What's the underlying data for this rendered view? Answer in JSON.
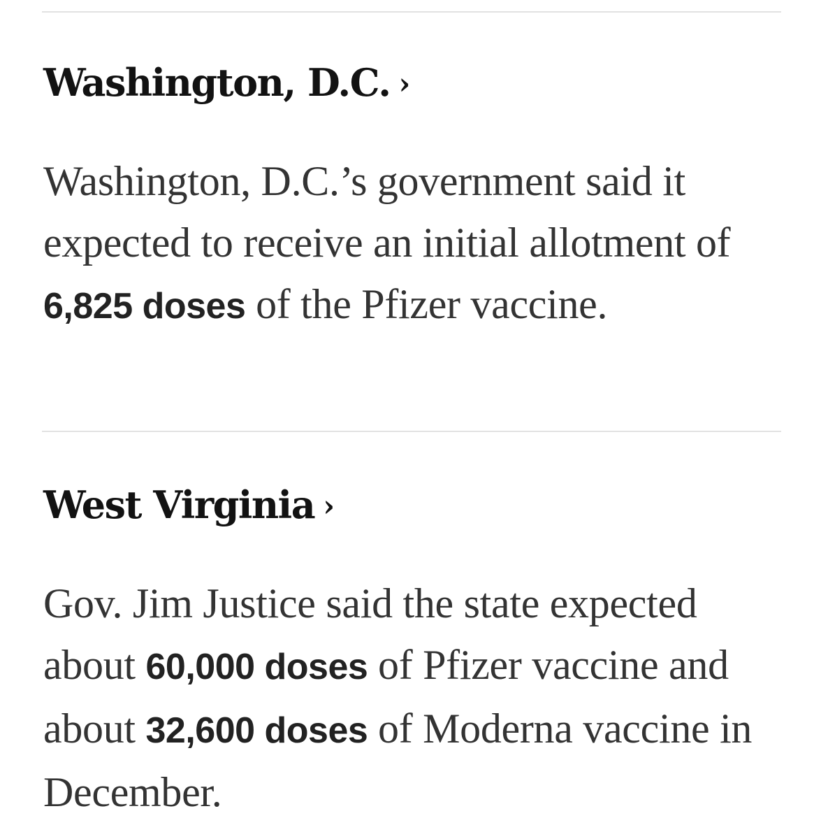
{
  "entries": [
    {
      "heading": "Washington, D.C.",
      "chevron": "›",
      "body": {
        "p1": "Washington, D.C.’s government said it expected to receive an initial allotment of ",
        "b1": "6,825 doses",
        "p2": " of the Pfizer vaccine."
      }
    },
    {
      "heading": "West Virginia",
      "chevron": "›",
      "body": {
        "p1": "Gov. Jim Justice said the state expected about ",
        "b1": "60,000 doses",
        "p2": " of Pfizer vaccine and about ",
        "b2": "32,600 doses",
        "p3": " of Moderna vaccine in December."
      }
    }
  ]
}
